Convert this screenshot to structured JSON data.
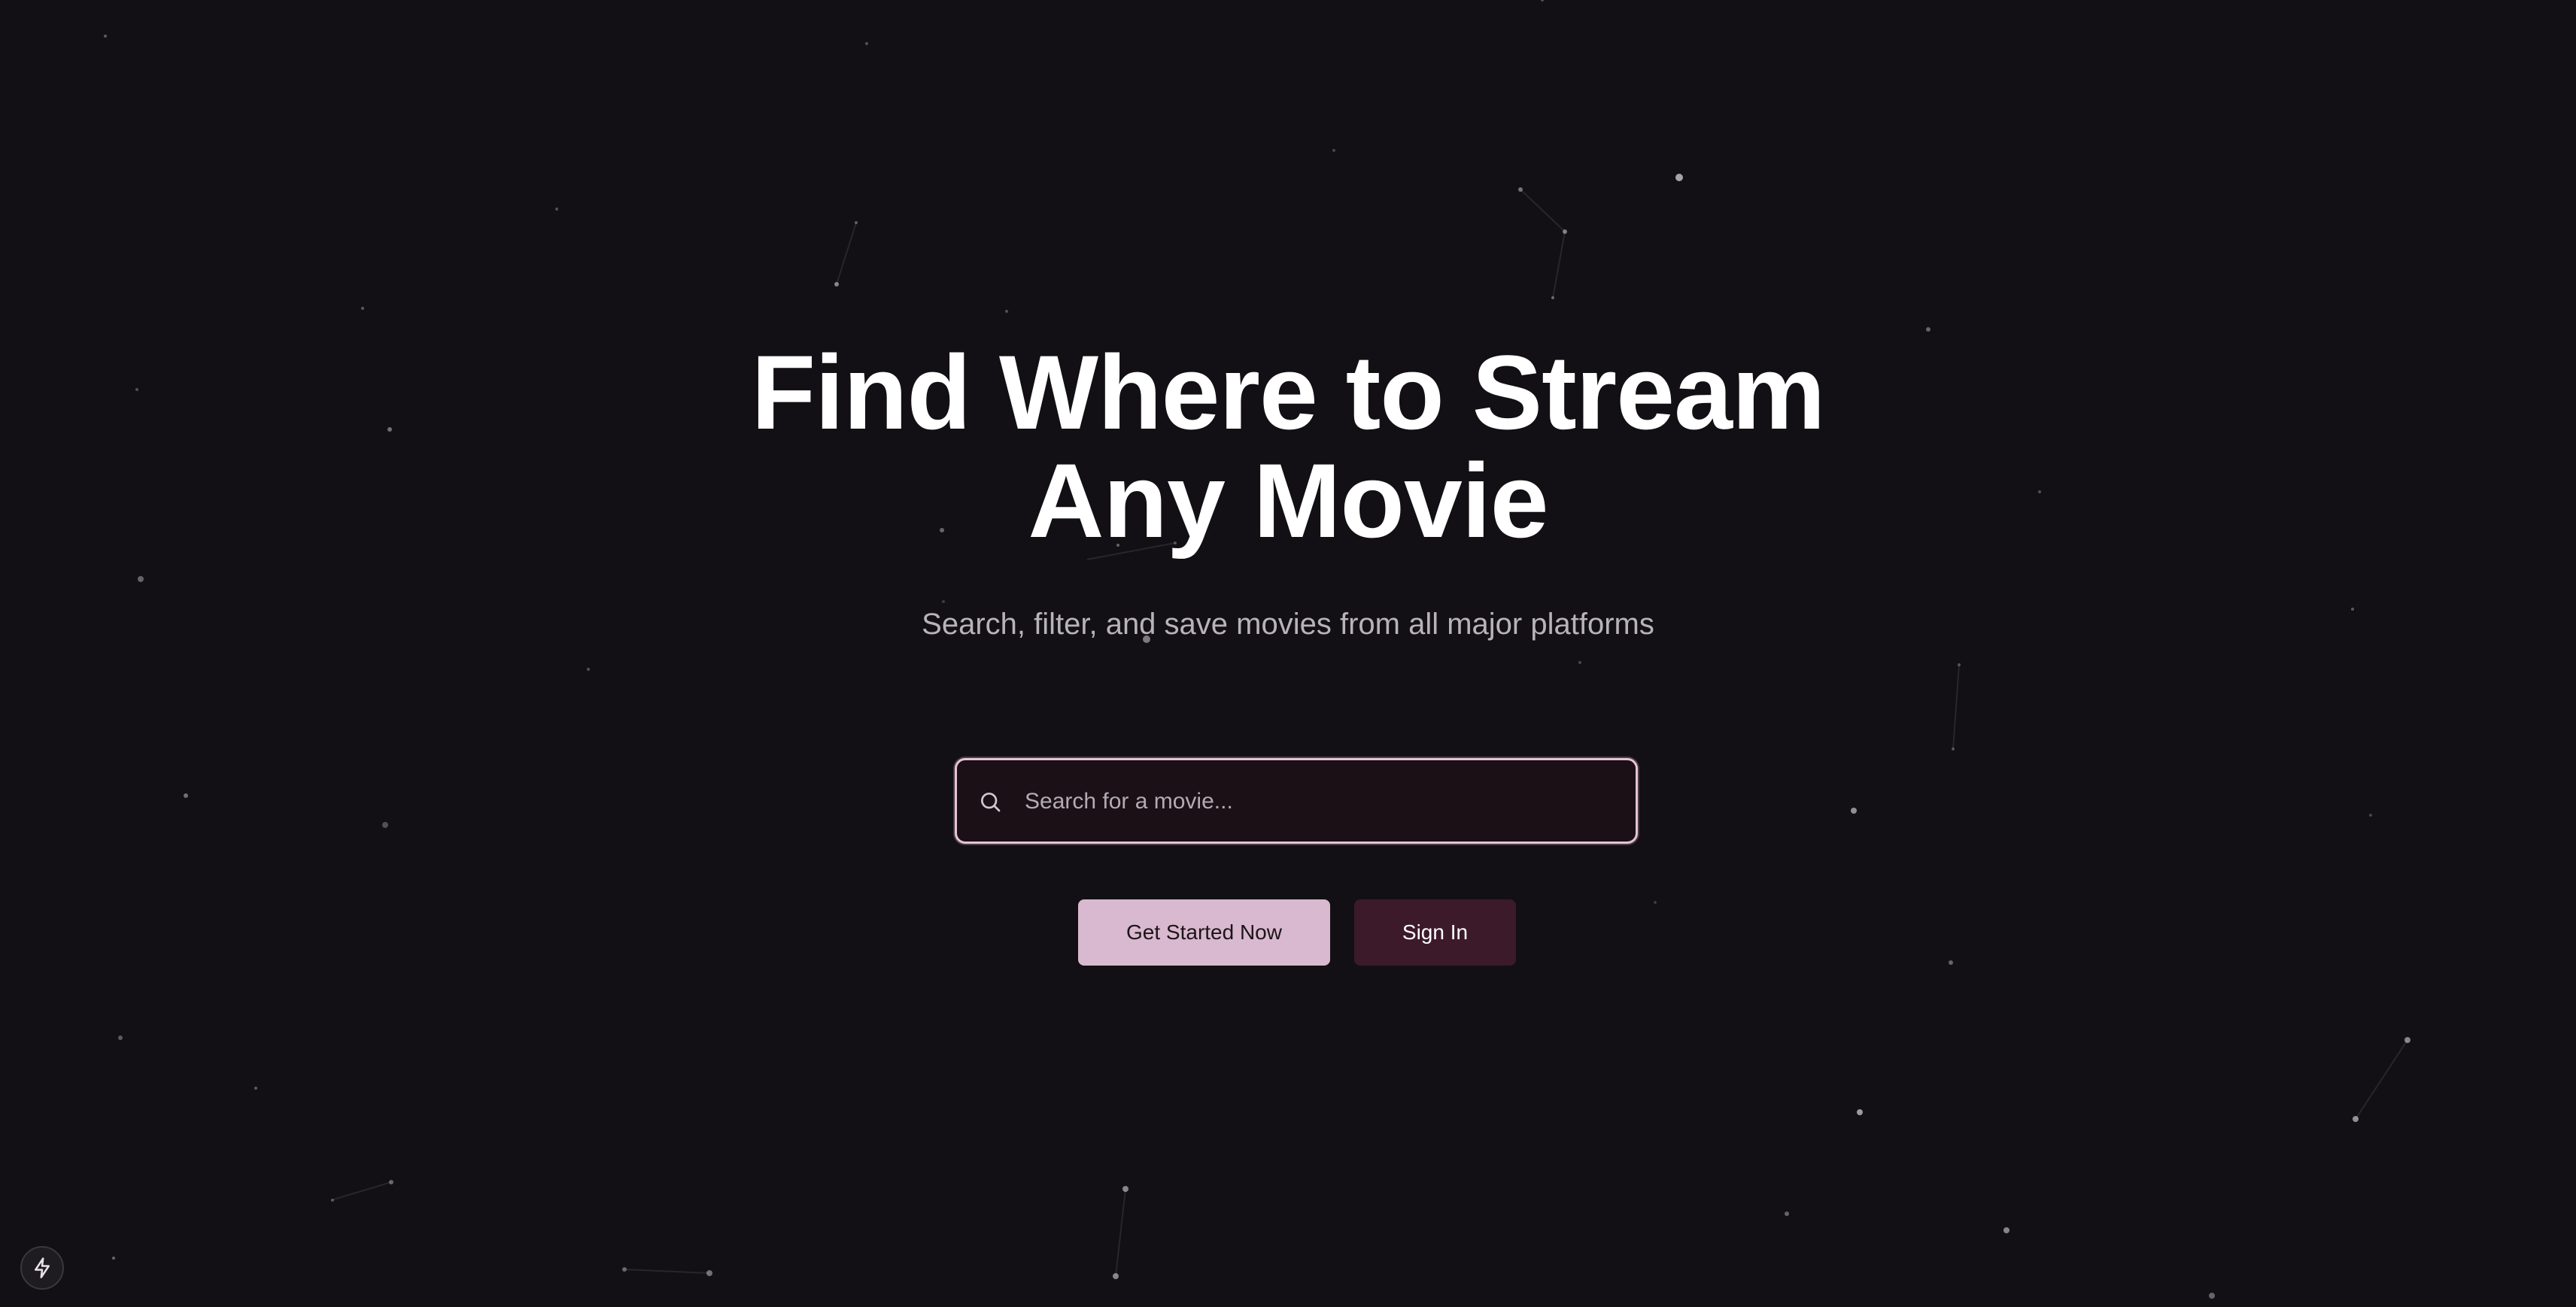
{
  "hero": {
    "title_line1": "Find Where to Stream",
    "title_line2": "Any Movie",
    "subtitle": "Search, filter, and save movies from all major platforms"
  },
  "search": {
    "placeholder": "Search for a movie...",
    "value": ""
  },
  "actions": {
    "primary_label": "Get Started Now",
    "secondary_label": "Sign In"
  },
  "icons": {
    "search": "search-icon",
    "badge": "lightning-bolt-icon"
  },
  "colors": {
    "background": "#121014",
    "accent": "#d9b9cf",
    "accent_dark": "#3c1a2a",
    "search_border": "#e7c3d3",
    "text_primary": "#ffffff",
    "text_muted": "#b8b3bb"
  }
}
